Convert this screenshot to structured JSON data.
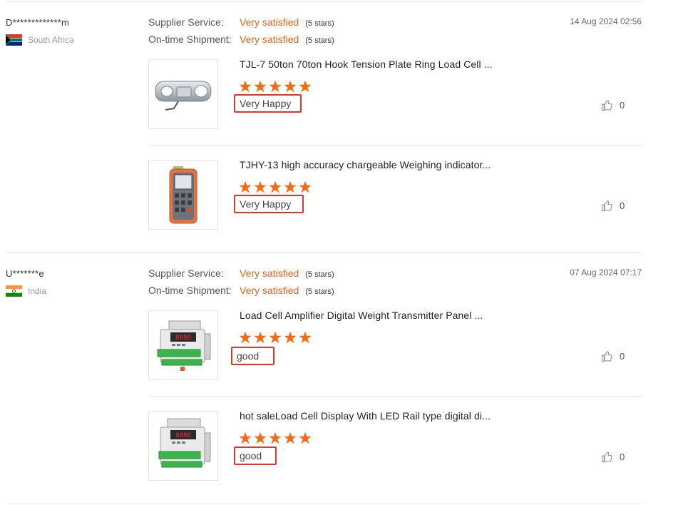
{
  "reviews": [
    {
      "buyer": "D*************m",
      "country": "South Africa",
      "date": "14 Aug 2024 02:56",
      "supplier_service": {
        "label": "Supplier Service:",
        "value": "Very satisfied",
        "stars": "(5 stars)"
      },
      "on_time_shipment": {
        "label": "On-time Shipment:",
        "value": "Very satisfied",
        "stars": "(5 stars)"
      },
      "products": [
        {
          "title": "TJL-7 50ton 70ton Hook Tension Plate Ring Load Cell ...",
          "rating": 5,
          "comment": "Very Happy",
          "likes": "0",
          "image_icon": "load-cell-icon"
        },
        {
          "title": "TJHY-13 high accuracy chargeable Weighing indicator...",
          "rating": 5,
          "comment": "Very Happy",
          "likes": "0",
          "image_icon": "handheld-indicator-icon"
        }
      ]
    },
    {
      "buyer": "U*******e",
      "country": "India",
      "date": "07 Aug 2024 07:17",
      "supplier_service": {
        "label": "Supplier Service:",
        "value": "Very satisfied",
        "stars": "(5 stars)"
      },
      "on_time_shipment": {
        "label": "On-time Shipment:",
        "value": "Very satisfied",
        "stars": "(5 stars)"
      },
      "products": [
        {
          "title": "Load Cell Amplifier Digital Weight Transmitter Panel ...",
          "rating": 5,
          "comment": "good",
          "likes": "0",
          "image_icon": "din-rail-transmitter-icon"
        },
        {
          "title": "hot saleLoad Cell Display With LED Rail type digital di...",
          "rating": 5,
          "comment": "good",
          "likes": "0",
          "image_icon": "din-rail-display-icon"
        }
      ]
    }
  ],
  "colors": {
    "accent": "#e8621c",
    "star": "#f46b16",
    "highlight_box": "#e0362e"
  }
}
